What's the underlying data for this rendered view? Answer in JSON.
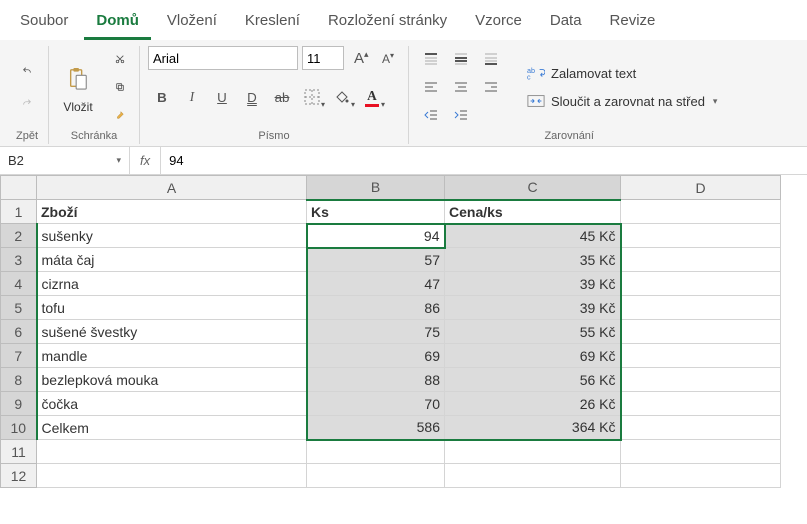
{
  "tabs": {
    "soubor": "Soubor",
    "domu": "Domů",
    "vlozeni": "Vložení",
    "kresleni": "Kreslení",
    "rozlozeni": "Rozložení stránky",
    "vzorce": "Vzorce",
    "data": "Data",
    "revize": "Revize"
  },
  "ribbon": {
    "historyLabel": "Zpět",
    "clipboard": {
      "pasteLabel": "Vložit",
      "groupLabel": "Schránka"
    },
    "font": {
      "fontName": "Arial",
      "fontSize": "11",
      "boldGlyph": "B",
      "italicGlyph": "I",
      "underlineGlyph": "U",
      "dUnderlineGlyph": "D",
      "strikeGlyph": "ab",
      "groupLabel": "Písmo"
    },
    "align": {
      "wrapLabel": "Zalamovat text",
      "mergeLabel": "Sloučit a zarovnat na střed",
      "groupLabel": "Zarovnání"
    }
  },
  "nameBox": "B2",
  "formula": "94",
  "columns": [
    "A",
    "B",
    "C",
    "D"
  ],
  "rows": [
    "1",
    "2",
    "3",
    "4",
    "5",
    "6",
    "7",
    "8",
    "9",
    "10",
    "11",
    "12"
  ],
  "sheet": {
    "hdrA": "Zboží",
    "hdrB": "Ks",
    "hdrC": "Cena/ks",
    "r2": {
      "a": "sušenky",
      "b": "94",
      "c": "45 Kč"
    },
    "r3": {
      "a": "máta čaj",
      "b": "57",
      "c": "35 Kč"
    },
    "r4": {
      "a": "cizrna",
      "b": "47",
      "c": "39 Kč"
    },
    "r5": {
      "a": "tofu",
      "b": "86",
      "c": "39 Kč"
    },
    "r6": {
      "a": "sušené švestky",
      "b": "75",
      "c": "55 Kč"
    },
    "r7": {
      "a": "mandle",
      "b": "69",
      "c": "69 Kč"
    },
    "r8": {
      "a": "bezlepková mouka",
      "b": "88",
      "c": "56 Kč"
    },
    "r9": {
      "a": "čočka",
      "b": "70",
      "c": "26 Kč"
    },
    "r10": {
      "a": "Celkem",
      "b": "586",
      "c": "364 Kč"
    }
  }
}
